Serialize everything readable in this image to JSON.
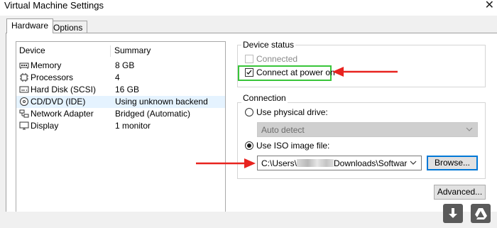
{
  "window": {
    "title": "Virtual Machine Settings"
  },
  "tabs": [
    {
      "label": "Hardware",
      "active": true
    },
    {
      "label": "Options",
      "active": false
    }
  ],
  "device_list": {
    "headers": {
      "device": "Device",
      "summary": "Summary"
    },
    "rows": [
      {
        "device": "Memory",
        "summary": "8 GB",
        "icon": "memory-icon"
      },
      {
        "device": "Processors",
        "summary": "4",
        "icon": "processor-icon"
      },
      {
        "device": "Hard Disk (SCSI)",
        "summary": "16 GB",
        "icon": "hard-disk-icon"
      },
      {
        "device": "CD/DVD (IDE)",
        "summary": "Using unknown backend",
        "icon": "cd-dvd-icon",
        "selected": true
      },
      {
        "device": "Network Adapter",
        "summary": "Bridged (Automatic)",
        "icon": "network-adapter-icon"
      },
      {
        "device": "Display",
        "summary": "1 monitor",
        "icon": "display-icon"
      }
    ]
  },
  "device_status": {
    "label": "Device status",
    "connected": {
      "label": "Connected",
      "checked": false,
      "enabled": false
    },
    "connect_at_power_on": {
      "label": "Connect at power on",
      "checked": true,
      "enabled": true
    }
  },
  "connection": {
    "label": "Connection",
    "physical_drive": {
      "label": "Use physical drive:",
      "selected": false,
      "dropdown_value": "Auto detect"
    },
    "iso_image": {
      "label": "Use ISO image file:",
      "selected": true,
      "path_before": "C:\\Users\\",
      "path_after": "Downloads\\Software\\Sim"
    },
    "browse_label": "Browse..."
  },
  "advanced_label": "Advanced...",
  "colors": {
    "highlight": "#39c53a",
    "arrow": "#e8231f",
    "selection": "#e5f3ff",
    "focus_border": "#0078d7"
  }
}
